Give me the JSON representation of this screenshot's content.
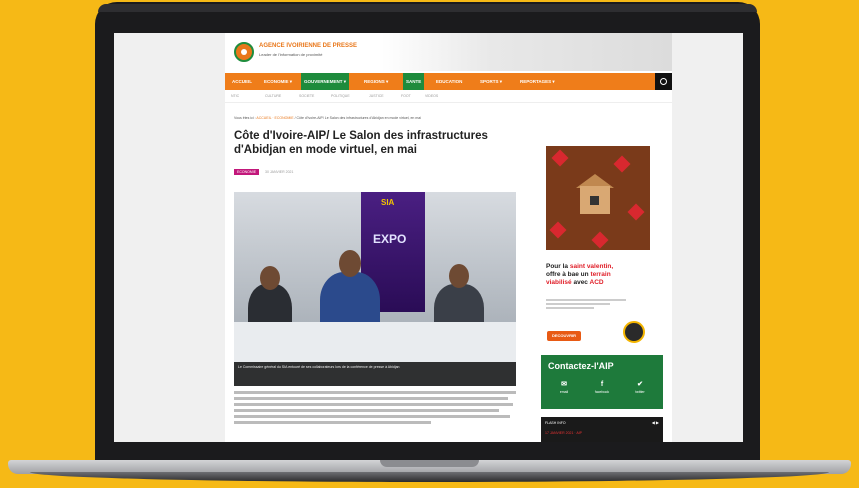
{
  "site": {
    "brand": "AGENCE IVOIRIENNE DE PRESSE",
    "tagline": "Leader de l'information de proximité",
    "colors": {
      "orange": "#ef7d1a",
      "green": "#1e8b3c",
      "background": "#f6b916"
    }
  },
  "nav": {
    "items": [
      "ACCUEIL",
      "ECONOMIE ▾",
      "GOUVERNEMENT ▾",
      "REGIONS ▾",
      "SANTE",
      "EDUCATION",
      "SPORTS ▾",
      "REPORTAGES ▾"
    ],
    "search_icon": "search-icon"
  },
  "subnav": {
    "items": [
      "NTIC",
      "CULTURE",
      "SOCIETE",
      "POLITIQUE",
      "JUSTICE",
      "FOOT",
      "VIDEOS"
    ]
  },
  "breadcrumb": {
    "prefix": "Vous êtes ici : ",
    "link": "ACCUEIL · ECONOMIE",
    "current": " / Côte d'Ivoire-AIP/ Le Salon des infrastructures d'Abidjan en mode virtuel, en mai"
  },
  "article": {
    "title": "Côte d'Ivoire-AIP/ Le Salon des infrastructures d'Abidjan en mode virtuel, en mai",
    "category": "ECONOMIE",
    "date": "30 JANVIER 2021",
    "photo_banner_top": "SIA",
    "photo_banner_main": "EXPO",
    "caption": "Le Commissaire général du SIA entouré de ses collaborateurs lors de la conférence de presse à Abidjan"
  },
  "sidebar": {
    "ad": {
      "line1_plain": "Pour la ",
      "line1_red": "saint valentin,",
      "line2_plain": "offre à bae un ",
      "line2_red": "terrain",
      "line3_red": "viabilisé",
      "line3_plain": " avec ",
      "line3_red2": "ACD",
      "button": "DECOUVRIR"
    },
    "contact": {
      "title": "Contactez-l'AIP",
      "items": [
        {
          "icon": "✉",
          "label": "email"
        },
        {
          "icon": "f",
          "label": "facebook"
        },
        {
          "icon": "✔",
          "label": "twitter"
        }
      ]
    },
    "flash": {
      "head": "FLASH INFO",
      "row": "17 JANVIER 2021 · AIP"
    }
  }
}
